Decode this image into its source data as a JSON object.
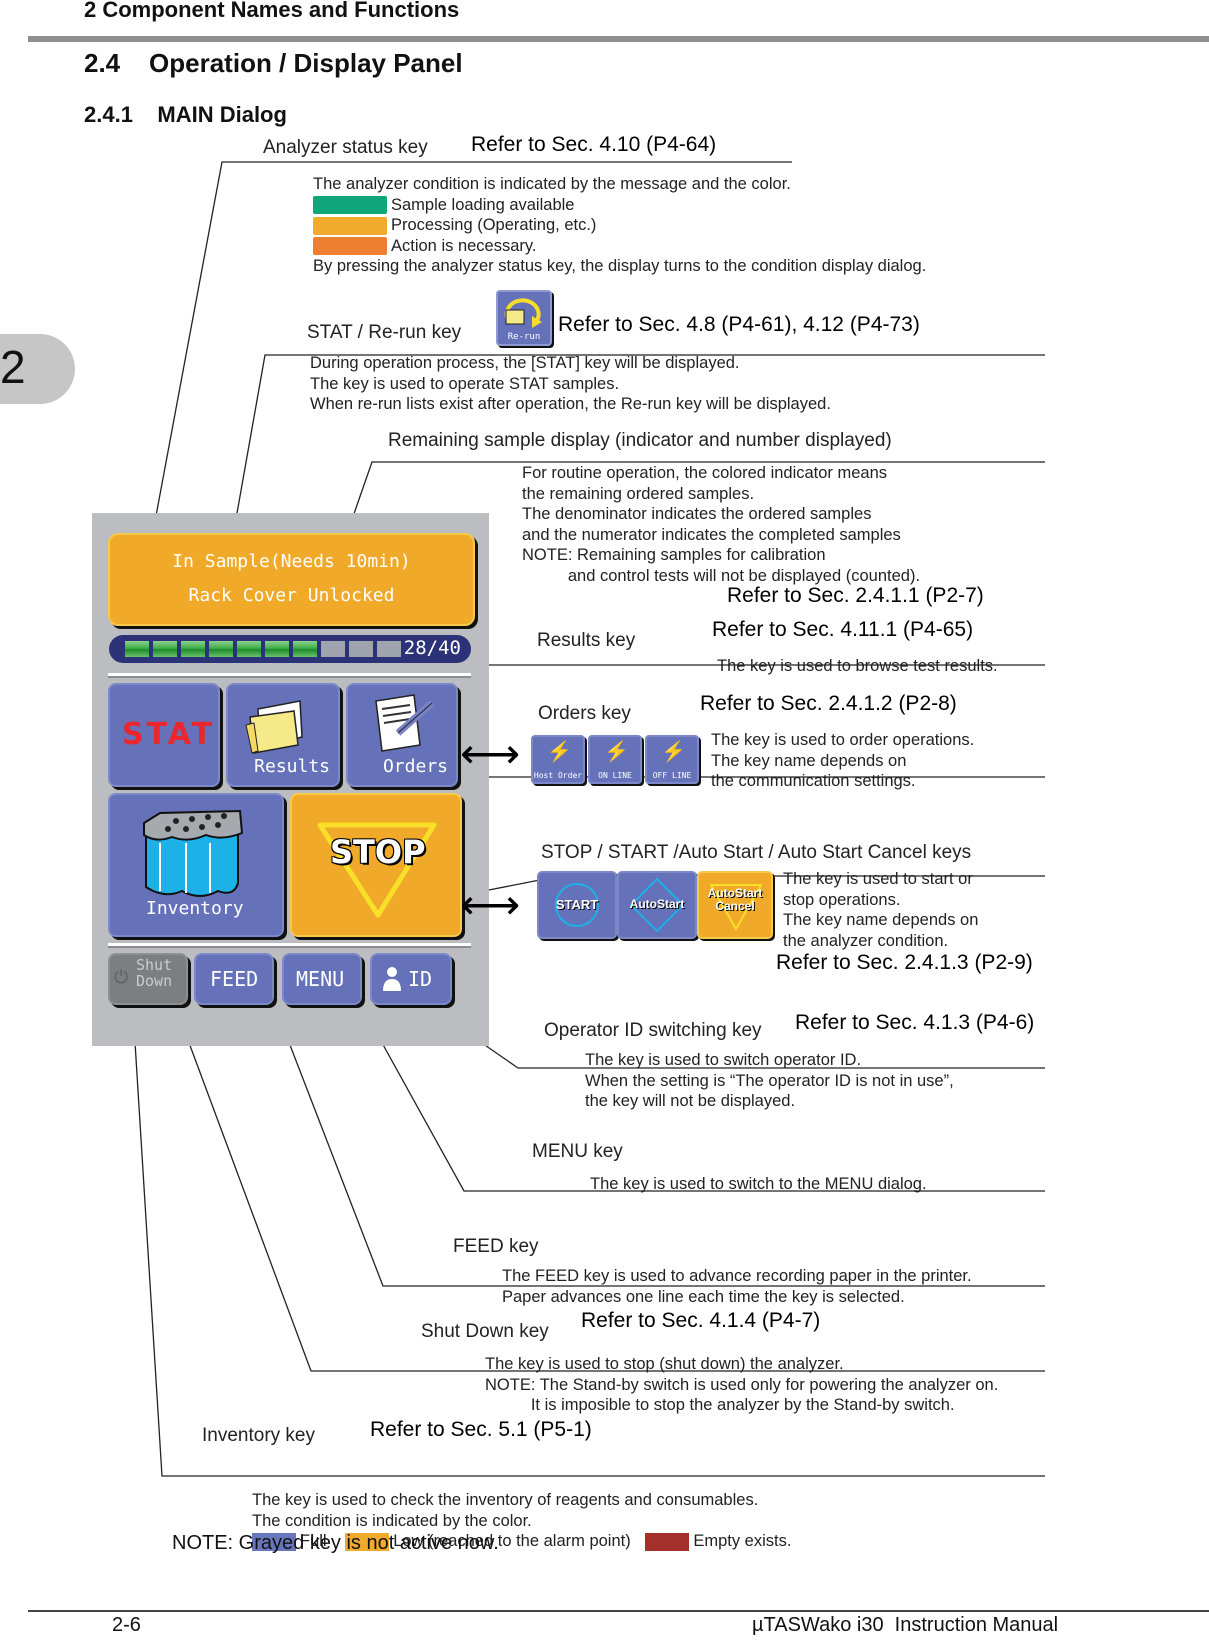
{
  "header": {
    "chapter_title": "2 Component Names and Functions",
    "section_title": "2.4    Operation / Display Panel",
    "subsection_title": "2.4.1    MAIN Dialog",
    "chapter_tab": "2"
  },
  "callouts": {
    "analyzer_status": {
      "label": "Analyzer status key",
      "ref": "Refer to Sec.  4.10 (P4-64)",
      "intro": "The analyzer condition is indicated by the message and the color.",
      "legend": [
        {
          "color": "#0fa77a",
          "text": "Sample loading available"
        },
        {
          "color": "#f0ab2c",
          "text": "Processing (Operating, etc.)"
        },
        {
          "color": "#ee7f30",
          "text": "Action is necessary."
        }
      ],
      "outro": "By pressing the analyzer status key, the display turns to the condition display dialog."
    },
    "stat_rerun": {
      "label": "STAT / Re-run key",
      "icon_caption": "Re-run",
      "ref": "Refer to Sec.  4.8 (P4-61), 4.12 (P4-73)",
      "lines": [
        "During operation process, the [STAT] key will be displayed.",
        "The key is used to operate STAT samples.",
        "When re-run lists exist after operation, the Re-run key will be displayed."
      ]
    },
    "remaining": {
      "label": "Remaining sample display (indicator and number displayed)",
      "lines": [
        "For routine operation, the colored indicator means",
        "the remaining ordered samples.",
        "The denominator indicates the ordered samples",
        "and the numerator indicates the completed samples",
        "NOTE: Remaining samples for calibration",
        "          and control tests will not be displayed (counted)."
      ],
      "ref": "Refer to Sec.  2.4.1.1 (P2-7)"
    },
    "results": {
      "label": "Results key",
      "ref": "Refer to Sec.  4.11.1 (P4-65)",
      "desc": "The key is used to browse test results."
    },
    "orders": {
      "label": "Orders key",
      "ref": "Refer to Sec.  2.4.1.2 (P2-8)",
      "variants": [
        "Host Order",
        "ON LINE",
        "OFF LINE"
      ],
      "lines": [
        "The key is used to order operations.",
        "The key name depends on",
        "the communication settings."
      ]
    },
    "stop_start": {
      "label": "STOP / START /Auto Start / Auto Start Cancel keys",
      "variants": [
        "START",
        "AutoStart",
        "AutoStart Cancel"
      ],
      "lines": [
        "The key is used to start or",
        "stop operations.",
        "The key name depends on",
        "the analyzer condition."
      ],
      "ref": "Refer to Sec.  2.4.1.3 (P2-9)"
    },
    "operator_id": {
      "label": "Operator ID switching key",
      "ref": "Refer to Sec.  4.1.3 (P4-6)",
      "lines": [
        "The key is used to switch operator ID.",
        "When the setting is “The operator ID is not in use”,",
        "the key will not be displayed."
      ]
    },
    "menu": {
      "label": "MENU key",
      "desc": "The key is used to switch to the MENU dialog."
    },
    "feed": {
      "label": "FEED key",
      "lines": [
        "The FEED key is used to advance recording paper in the printer.",
        "Paper advances one line each time the key is selected."
      ]
    },
    "shutdown": {
      "label": "Shut Down key",
      "ref": "Refer to Sec.  4.1.4 (P4-7)",
      "lines": [
        "The key is used to stop (shut down) the analyzer.",
        "NOTE: The Stand-by switch is used only for powering the analyzer on.",
        "          It is imposible to stop the analyzer by the Stand-by switch."
      ]
    },
    "inventory": {
      "label": "Inventory key",
      "ref": "Refer to Sec.  5.1 (P5-1)",
      "lines": [
        "The key is used to check the inventory of reagents and consumables.",
        "The condition is indicated by the color."
      ],
      "legend": [
        {
          "color": "#6877bd",
          "text": "Full"
        },
        {
          "color": "#f0ab2c",
          "text": "Low (reached to the alarm point)"
        },
        {
          "color": "#a3302b",
          "text": "Empty exists."
        }
      ]
    }
  },
  "panel": {
    "status_line1": "In Sample(Needs 10min)",
    "status_line2": "Rack Cover Unlocked",
    "progress_text": "28/40",
    "progress_segments_total": 10,
    "progress_segments_filled": 7,
    "stat_label": "STAT",
    "results_label": "Results",
    "orders_label": "Orders",
    "inventory_label": "Inventory",
    "stop_label": "STOP",
    "shutdown_label": "Shut Down",
    "feed_label": "FEED",
    "menu_label": "MENU",
    "id_label": "ID"
  },
  "note": "NOTE:  Grayed key is not active now.",
  "footer": {
    "page": "2-6",
    "manual": "µTASWako i30  Instruction Manual"
  }
}
